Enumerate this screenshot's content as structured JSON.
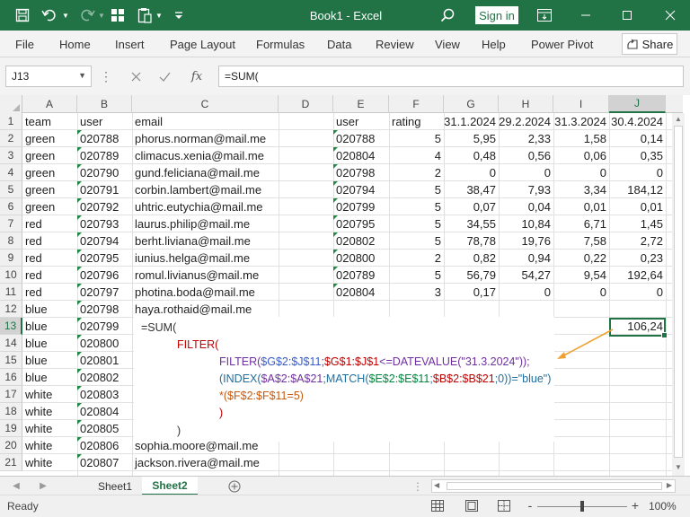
{
  "title_bar": {
    "title": "Book1 - Excel",
    "sign_in": "Sign in",
    "icons": [
      "save-icon",
      "undo-icon",
      "redo-icon",
      "table-icon",
      "paste-icon",
      "customize-icon",
      "search-icon",
      "ribbon-display-icon",
      "minimize-icon",
      "maximize-icon",
      "close-icon"
    ]
  },
  "ribbon": {
    "tabs": [
      "File",
      "Home",
      "Insert",
      "Page Layout",
      "Formulas",
      "Data",
      "Review",
      "View",
      "Help",
      "Power Pivot"
    ],
    "share": "Share"
  },
  "formula_bar": {
    "name_box": "J13",
    "formula": "=SUM(",
    "fx": "fx"
  },
  "columns": [
    "A",
    "B",
    "C",
    "D",
    "E",
    "F",
    "G",
    "H",
    "I",
    "J"
  ],
  "selected_cell": {
    "column": "J",
    "row": "13"
  },
  "row_numbers": [
    "1",
    "2",
    "3",
    "4",
    "5",
    "6",
    "7",
    "8",
    "9",
    "10",
    "11",
    "12",
    "13",
    "14",
    "15",
    "16",
    "17",
    "18",
    "19",
    "20",
    "21"
  ],
  "sheet": {
    "A": [
      "team",
      "green",
      "green",
      "green",
      "green",
      "green",
      "red",
      "red",
      "red",
      "red",
      "red",
      "blue",
      "blue",
      "blue",
      "blue",
      "blue",
      "white",
      "white",
      "white",
      "white",
      "white"
    ],
    "B": [
      "user",
      "020788",
      "020789",
      "020790",
      "020791",
      "020792",
      "020793",
      "020794",
      "020795",
      "020796",
      "020797",
      "020798",
      "020799",
      "020800",
      "020801",
      "020802",
      "020803",
      "020804",
      "020805",
      "020806",
      "020807"
    ],
    "C": [
      "email",
      "phorus.norman@mail.me",
      "climacus.xenia@mail.me",
      "gund.feliciana@mail.me",
      "corbin.lambert@mail.me",
      "uhtric.eutychia@mail.me",
      "laurus.philip@mail.me",
      "berht.liviana@mail.me",
      "iunius.helga@mail.me",
      "romul.livianus@mail.me",
      "photina.boda@mail.me",
      "haya.rothaid@mail.me",
      "",
      "",
      "",
      "",
      "",
      "",
      "",
      "sophia.moore@mail.me",
      "jackson.rivera@mail.me"
    ],
    "E": [
      "user",
      "020788",
      "020804",
      "020798",
      "020794",
      "020799",
      "020795",
      "020802",
      "020800",
      "020789",
      "020804"
    ],
    "F": [
      "rating",
      "5",
      "4",
      "2",
      "5",
      "5",
      "5",
      "5",
      "2",
      "5",
      "3"
    ],
    "G": [
      "31.1.2024",
      "5,95",
      "0,48",
      "0",
      "38,47",
      "0,07",
      "34,55",
      "78,78",
      "0,82",
      "56,79",
      "0,17"
    ],
    "H": [
      "29.2.2024",
      "2,33",
      "0,56",
      "0",
      "7,93",
      "0,04",
      "10,84",
      "19,76",
      "0,94",
      "54,27",
      "0"
    ],
    "I": [
      "31.3.2024",
      "1,58",
      "0,06",
      "0",
      "3,34",
      "0,01",
      "6,71",
      "7,58",
      "0,22",
      "9,54",
      "0"
    ],
    "J": [
      "30.4.2024",
      "0,14",
      "0,35",
      "0",
      "184,12",
      "0,01",
      "1,45",
      "2,72",
      "0,23",
      "192,64",
      "0"
    ],
    "J13": "106,24"
  },
  "callout": {
    "l1": "=SUM(",
    "l2": "FILTER(",
    "l3_a": "FILTER(",
    "l3_b": "$G$2:$J$11",
    "l3_c": ";",
    "l3_d": "$G$1:$J$1",
    "l3_e": "<=DATEVALUE(\"31.3.2024\"));",
    "l4_a": "(INDEX(",
    "l4_b": "$A$2:$A$21",
    "l4_c": ";MATCH(",
    "l4_d": "$E$2:$E$11",
    "l4_e": ";",
    "l4_f": "$B$2:$B$21",
    "l4_g": ";0))=\"blue\")",
    "l5_a": "*(",
    "l5_b": "$F$2:$F$11",
    "l5_c": "=5)",
    "l6": ")",
    "l7": ")"
  },
  "sheet_tabs": [
    "Sheet1",
    "Sheet2"
  ],
  "active_sheet": "Sheet2",
  "status": {
    "ready": "Ready",
    "zoom": "100%",
    "zoom_minus": "-",
    "zoom_plus": "+"
  },
  "colors": {
    "accent": "#217346",
    "arrow": "#f0a030"
  }
}
